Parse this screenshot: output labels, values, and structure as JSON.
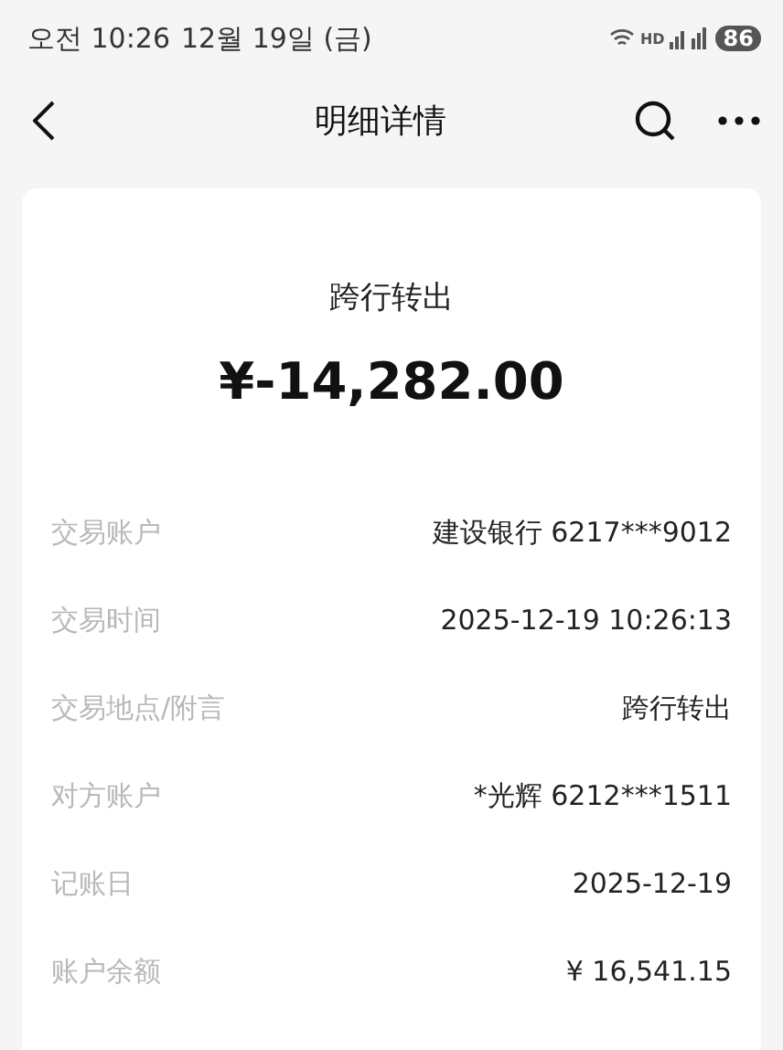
{
  "status_bar": {
    "time": "오전 10:26",
    "date": "12월 19일 (금)",
    "network": "HD",
    "battery": "86"
  },
  "header": {
    "title": "明细详情"
  },
  "summary": {
    "type": "跨行转出",
    "amount": "¥-14,282.00"
  },
  "details": [
    {
      "label": "交易账户",
      "value": "建设银行 6217***9012"
    },
    {
      "label": "交易时间",
      "value": "2025-12-19 10:26:13"
    },
    {
      "label": "交易地点/附言",
      "value": "跨行转出"
    },
    {
      "label": "对方账户",
      "value": "*光辉 6212***1511"
    },
    {
      "label": "记账日",
      "value": "2025-12-19"
    },
    {
      "label": "账户余额",
      "value": "¥ 16,541.15"
    }
  ]
}
